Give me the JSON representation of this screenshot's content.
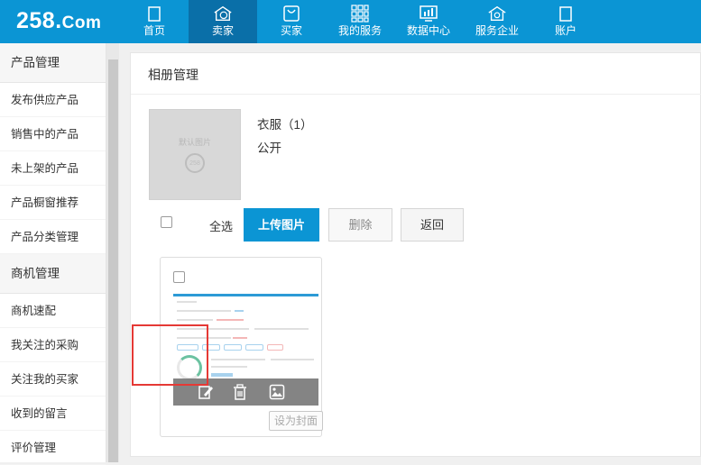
{
  "brand": {
    "logo_main": "258.",
    "logo_tail": "Com"
  },
  "nav": [
    {
      "label": "首页",
      "icon": "home-icon"
    },
    {
      "label": "卖家",
      "icon": "seller-icon"
    },
    {
      "label": "买家",
      "icon": "buyer-bag-icon"
    },
    {
      "label": "我的服务",
      "icon": "services-grid-icon"
    },
    {
      "label": "数据中心",
      "icon": "data-chart-icon"
    },
    {
      "label": "服务企业",
      "icon": "enterprise-icon"
    },
    {
      "label": "账户",
      "icon": "account-icon"
    }
  ],
  "sidebar": {
    "sections": [
      {
        "header": "产品管理",
        "items": [
          "发布供应产品",
          "销售中的产品",
          "未上架的产品",
          "产品橱窗推荐",
          "产品分类管理"
        ]
      },
      {
        "header": "商机管理",
        "items": [
          "商机速配",
          "我关注的采购",
          "关注我的买家",
          "收到的留言",
          "评价管理"
        ]
      }
    ]
  },
  "main": {
    "title": "相册管理",
    "album": {
      "name": "衣服（1）",
      "visibility": "公开",
      "thumb_text": "默认图片",
      "thumb_logo": "258"
    },
    "toolbar": {
      "select_all": "全选",
      "upload": "上传图片",
      "delete": "删除",
      "back": "返回"
    },
    "photo": {
      "set_cover": "设为封面",
      "actions": [
        "edit-icon",
        "trash-icon",
        "image-icon"
      ]
    }
  },
  "colors": {
    "primary": "#0b95d4",
    "nav_active": "#0a6fa8",
    "highlight": "#e53935"
  }
}
